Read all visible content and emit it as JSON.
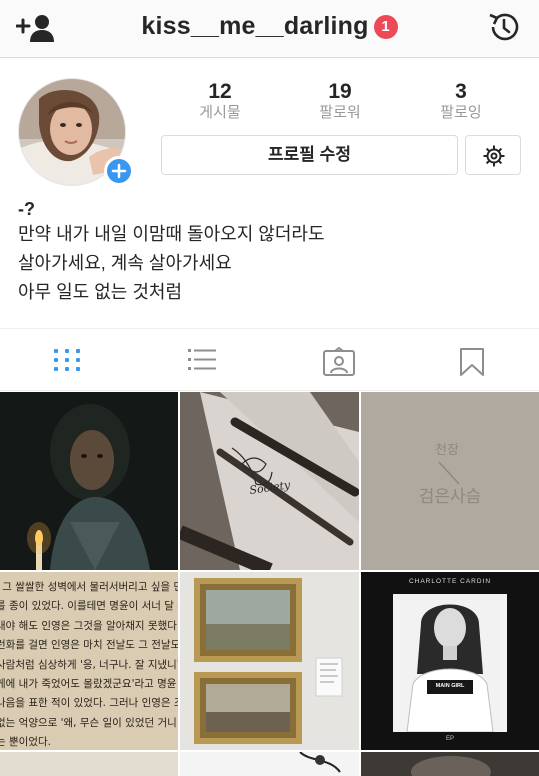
{
  "header": {
    "username": "kiss__me__darling",
    "notification_count": "1",
    "add_user_icon": "add-user-icon",
    "history_icon": "history-icon"
  },
  "profile": {
    "stats": [
      {
        "value": "12",
        "label": "게시물"
      },
      {
        "value": "19",
        "label": "팔로워"
      },
      {
        "value": "3",
        "label": "팔로잉"
      }
    ],
    "edit_profile_label": "프로필 수정",
    "settings_icon": "gear-icon",
    "bio_name": "-?",
    "bio_lines": [
      "만약 내가 내일 이맘때 돌아오지 않더라도",
      "살아가세요, 계속 살아가세요",
      "아무 일도 없는 것처럼"
    ]
  },
  "tabs": [
    {
      "icon": "grid-icon",
      "active": true
    },
    {
      "icon": "list-icon",
      "active": false
    },
    {
      "icon": "tagged-icon",
      "active": false
    },
    {
      "icon": "bookmark-icon",
      "active": false
    }
  ],
  "posts": {
    "p2_caption": "Society",
    "p3_text_top": "천장",
    "p3_text_bottom": "검은사슴",
    "p4_lines": [
      "l 그 쌀쌀한 성벽에서 물러서버리고 싶을 만",
      "를 종이 있었다. 이를테면 명윤이 서너 달 세",
      "내야 해도 인영은 그것을 알아채지 못했다.",
      "런화를 걸면 인영은 마치 전날도 그 전날도",
      "사람처럼 심상하게 '응, 너구나. 잘 지냈니?'",
      "게에 내가 죽었어도 몰랐겠군요'라고 명윤",
      "나음을 표한 적이 있었다. 그러나 인영은 조",
      "없는 억양으로 '왜, 무슨 일이 있었던 거니",
      "는 뿐이었다."
    ],
    "p6_artist": "CHARLOTTE CARDIN",
    "p6_shirt": "MAIN GIRL",
    "p6_ep": "EP"
  },
  "colors": {
    "accent": "#3897f0",
    "badge": "#ed4956",
    "muted": "#999999",
    "border": "#dbdbdb"
  }
}
